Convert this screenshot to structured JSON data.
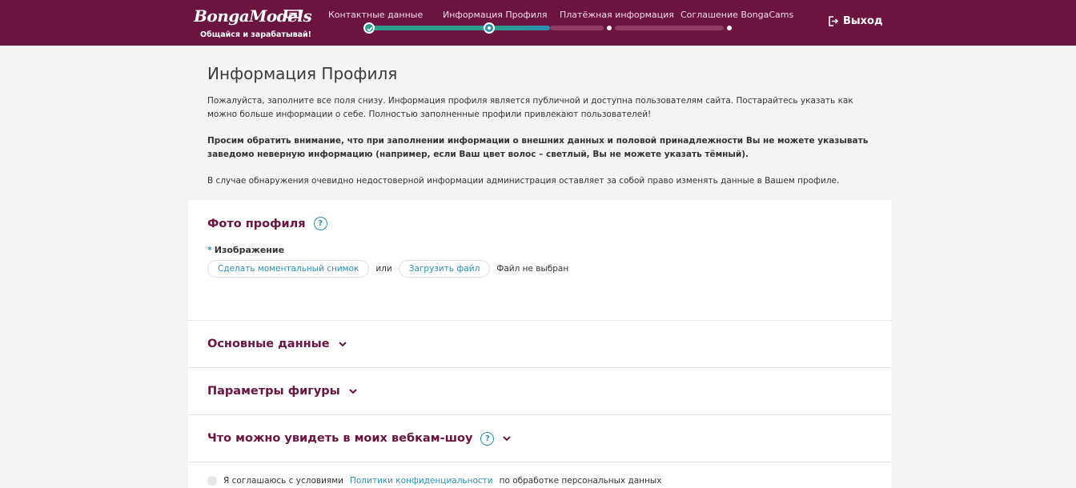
{
  "header": {
    "logo_text": "BongaModels",
    "logo_tagline": "Общайся и зарабатывай!",
    "steps": [
      {
        "label": "Контактные данные",
        "status": "done"
      },
      {
        "label": "Информация Профиля",
        "status": "current"
      },
      {
        "label": "Платёжная информация",
        "status": "todo"
      },
      {
        "label": "Соглашение BongaCams",
        "status": "todo"
      }
    ],
    "logout_label": "Выход"
  },
  "intro": {
    "title": "Информация Профиля",
    "paragraph1": "Пожалуйста, заполните все поля снизу. Информация профиля является публичной и доступна пользователям сайта. Постарайтесь указать как можно больше информации о себе. Полностью заполненные профили привлекают пользователей!",
    "paragraph2": "Просим обратить внимание, что при заполнении информации о внешних данных и половой принадлежности Вы не можете указывать заведомо неверную информацию (например, если Ваш цвет волос – светлый, Вы не можете указать тёмный).",
    "paragraph3": "В случае обнаружения очевидно недостоверной информации администрация оставляет за собой право изменять данные в Вашем профиле."
  },
  "photo_section": {
    "title": "Фото профиля",
    "field_label": "Изображение",
    "required_mark": "*",
    "snapshot_button": "Сделать моментальный снимок",
    "or_text": "или",
    "upload_button": "Загрузить файл",
    "file_status": "Файл не выбран"
  },
  "sections": {
    "basic": "Основные данные",
    "figure": "Параметры фигуры",
    "webcam": "Что можно увидеть в моих вебкам-шоу"
  },
  "consent": {
    "text_before": "Я соглашаюсь с условиями",
    "link_text": "Политики конфиденциальности",
    "text_after": "по обработке персональных данных"
  },
  "colors": {
    "header_bg": "#6b1440",
    "accent_teal": "#2d9e8a",
    "accent_blue": "#2a90b0",
    "title_maroon": "#6b1440"
  }
}
